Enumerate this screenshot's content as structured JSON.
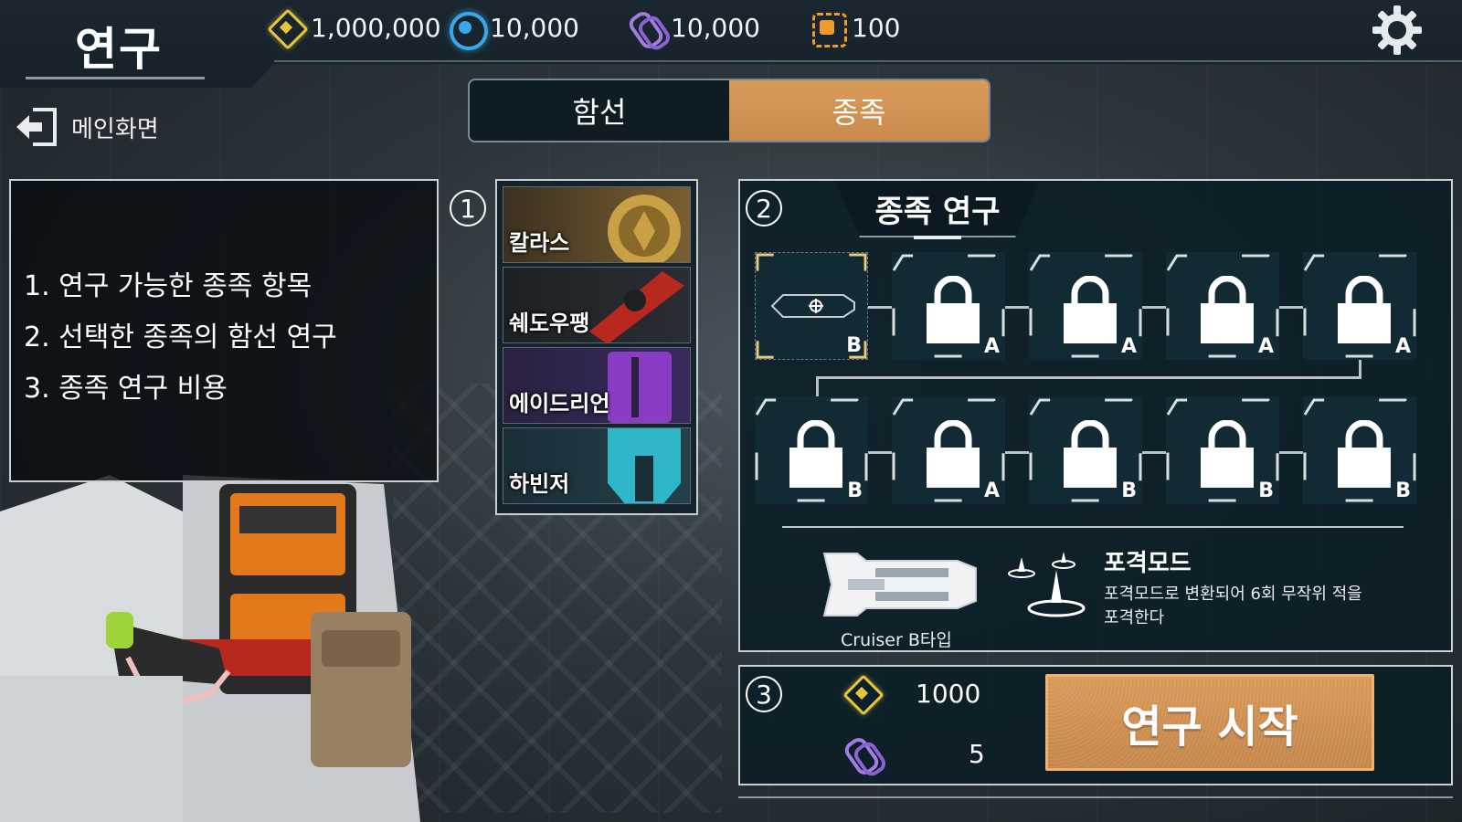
{
  "header": {
    "title": "연구",
    "resources": [
      {
        "icon": "gold-diamond-icon",
        "value": "1,000,000",
        "color": "#e6c43c"
      },
      {
        "icon": "blue-orb-icon",
        "value": "10,000",
        "color": "#3aa8e8"
      },
      {
        "icon": "purple-chain-icon",
        "value": "10,000",
        "color": "#a27de0"
      },
      {
        "icon": "orange-chip-icon",
        "value": "100",
        "color": "#ef9a2a"
      }
    ]
  },
  "back": {
    "label": "메인화면"
  },
  "tabs": [
    {
      "label": "함선",
      "active": false
    },
    {
      "label": "종족",
      "active": true
    }
  ],
  "info": {
    "lines": [
      "1.  연구 가능한 종족 항목",
      "2.  선택한 종족의 함선 연구",
      "3.  종족 연구 비용"
    ]
  },
  "markers": {
    "one": "1",
    "two": "2",
    "three": "3"
  },
  "races": [
    {
      "name": "칼라스",
      "color": "#c9a046"
    },
    {
      "name": "쉐도우팽",
      "color": "#b8281f"
    },
    {
      "name": "에이드리언",
      "color": "#8a3cc4"
    },
    {
      "name": "하빈저",
      "color": "#2fb6c8"
    }
  ],
  "research": {
    "title": "종족 연구",
    "row1": [
      {
        "grade": "B",
        "locked": false,
        "selected": true
      },
      {
        "grade": "A",
        "locked": true
      },
      {
        "grade": "A",
        "locked": true
      },
      {
        "grade": "A",
        "locked": true
      },
      {
        "grade": "A",
        "locked": true
      }
    ],
    "row2": [
      {
        "grade": "B",
        "locked": true
      },
      {
        "grade": "A",
        "locked": true
      },
      {
        "grade": "B",
        "locked": true
      },
      {
        "grade": "B",
        "locked": true
      },
      {
        "grade": "B",
        "locked": true
      }
    ],
    "ship_label": "Cruiser B타입",
    "skill_title": "포격모드",
    "skill_desc": "포격모드로 변환되어 6회 무작위 적을 포격한다"
  },
  "cost": {
    "gold": "1000",
    "purple": "5",
    "start_label": "연구 시작"
  },
  "colors": {
    "accent": "#d99a5a",
    "panel": "#0c1e26",
    "border": "#c8d0d4"
  }
}
